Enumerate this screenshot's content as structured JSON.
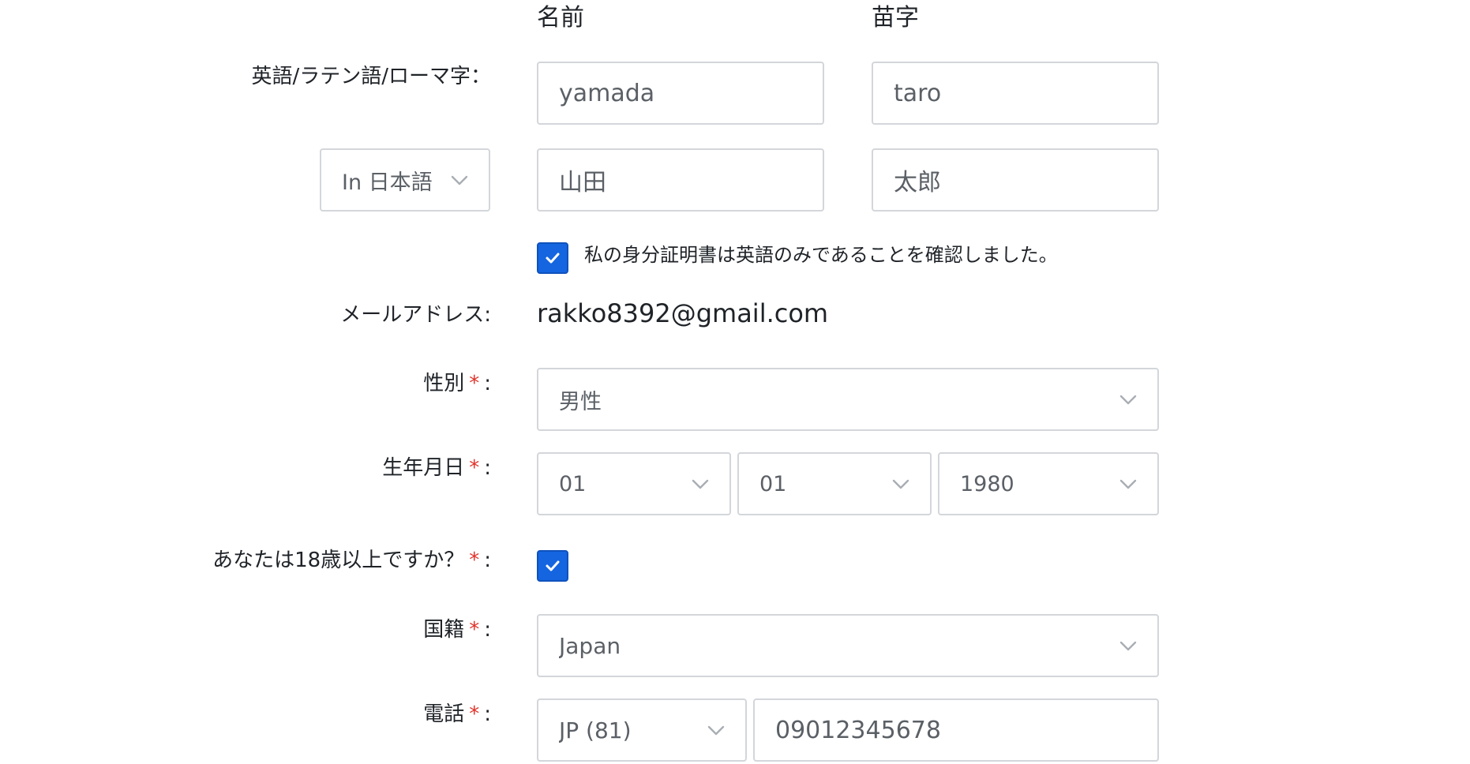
{
  "columns": {
    "first_name": "名前",
    "last_name": "苗字"
  },
  "latin_row": {
    "label": "英語/ラテン語/ローマ字：",
    "first_name_value": "yamada",
    "last_name_value": "taro"
  },
  "native_row": {
    "language_select": "In 日本語",
    "first_name_value": "山田",
    "last_name_value": "太郎"
  },
  "id_confirm": {
    "checked": true,
    "label": "私の身分証明書は英語のみであることを確認しました。"
  },
  "email": {
    "label": "メールアドレス:",
    "value": "rakko8392@gmail.com"
  },
  "gender": {
    "label": "性別",
    "required": "*",
    "colon": ":",
    "value": "男性"
  },
  "birthdate": {
    "label": "生年月日",
    "required": "*",
    "colon": ":",
    "month": "01",
    "day": "01",
    "year": "1980"
  },
  "adult": {
    "label": "あなたは18歳以上ですか？",
    "required": "*",
    "colon": ":",
    "checked": true
  },
  "nationality": {
    "label": "国籍",
    "required": "*",
    "colon": ":",
    "value": "Japan"
  },
  "phone": {
    "label": "電話",
    "required": "*",
    "colon": ":",
    "country_code": "JP (81)",
    "number": "09012345678"
  },
  "colors": {
    "accent": "#1565e0",
    "required": "#e0342b",
    "border": "#d3d6da"
  }
}
